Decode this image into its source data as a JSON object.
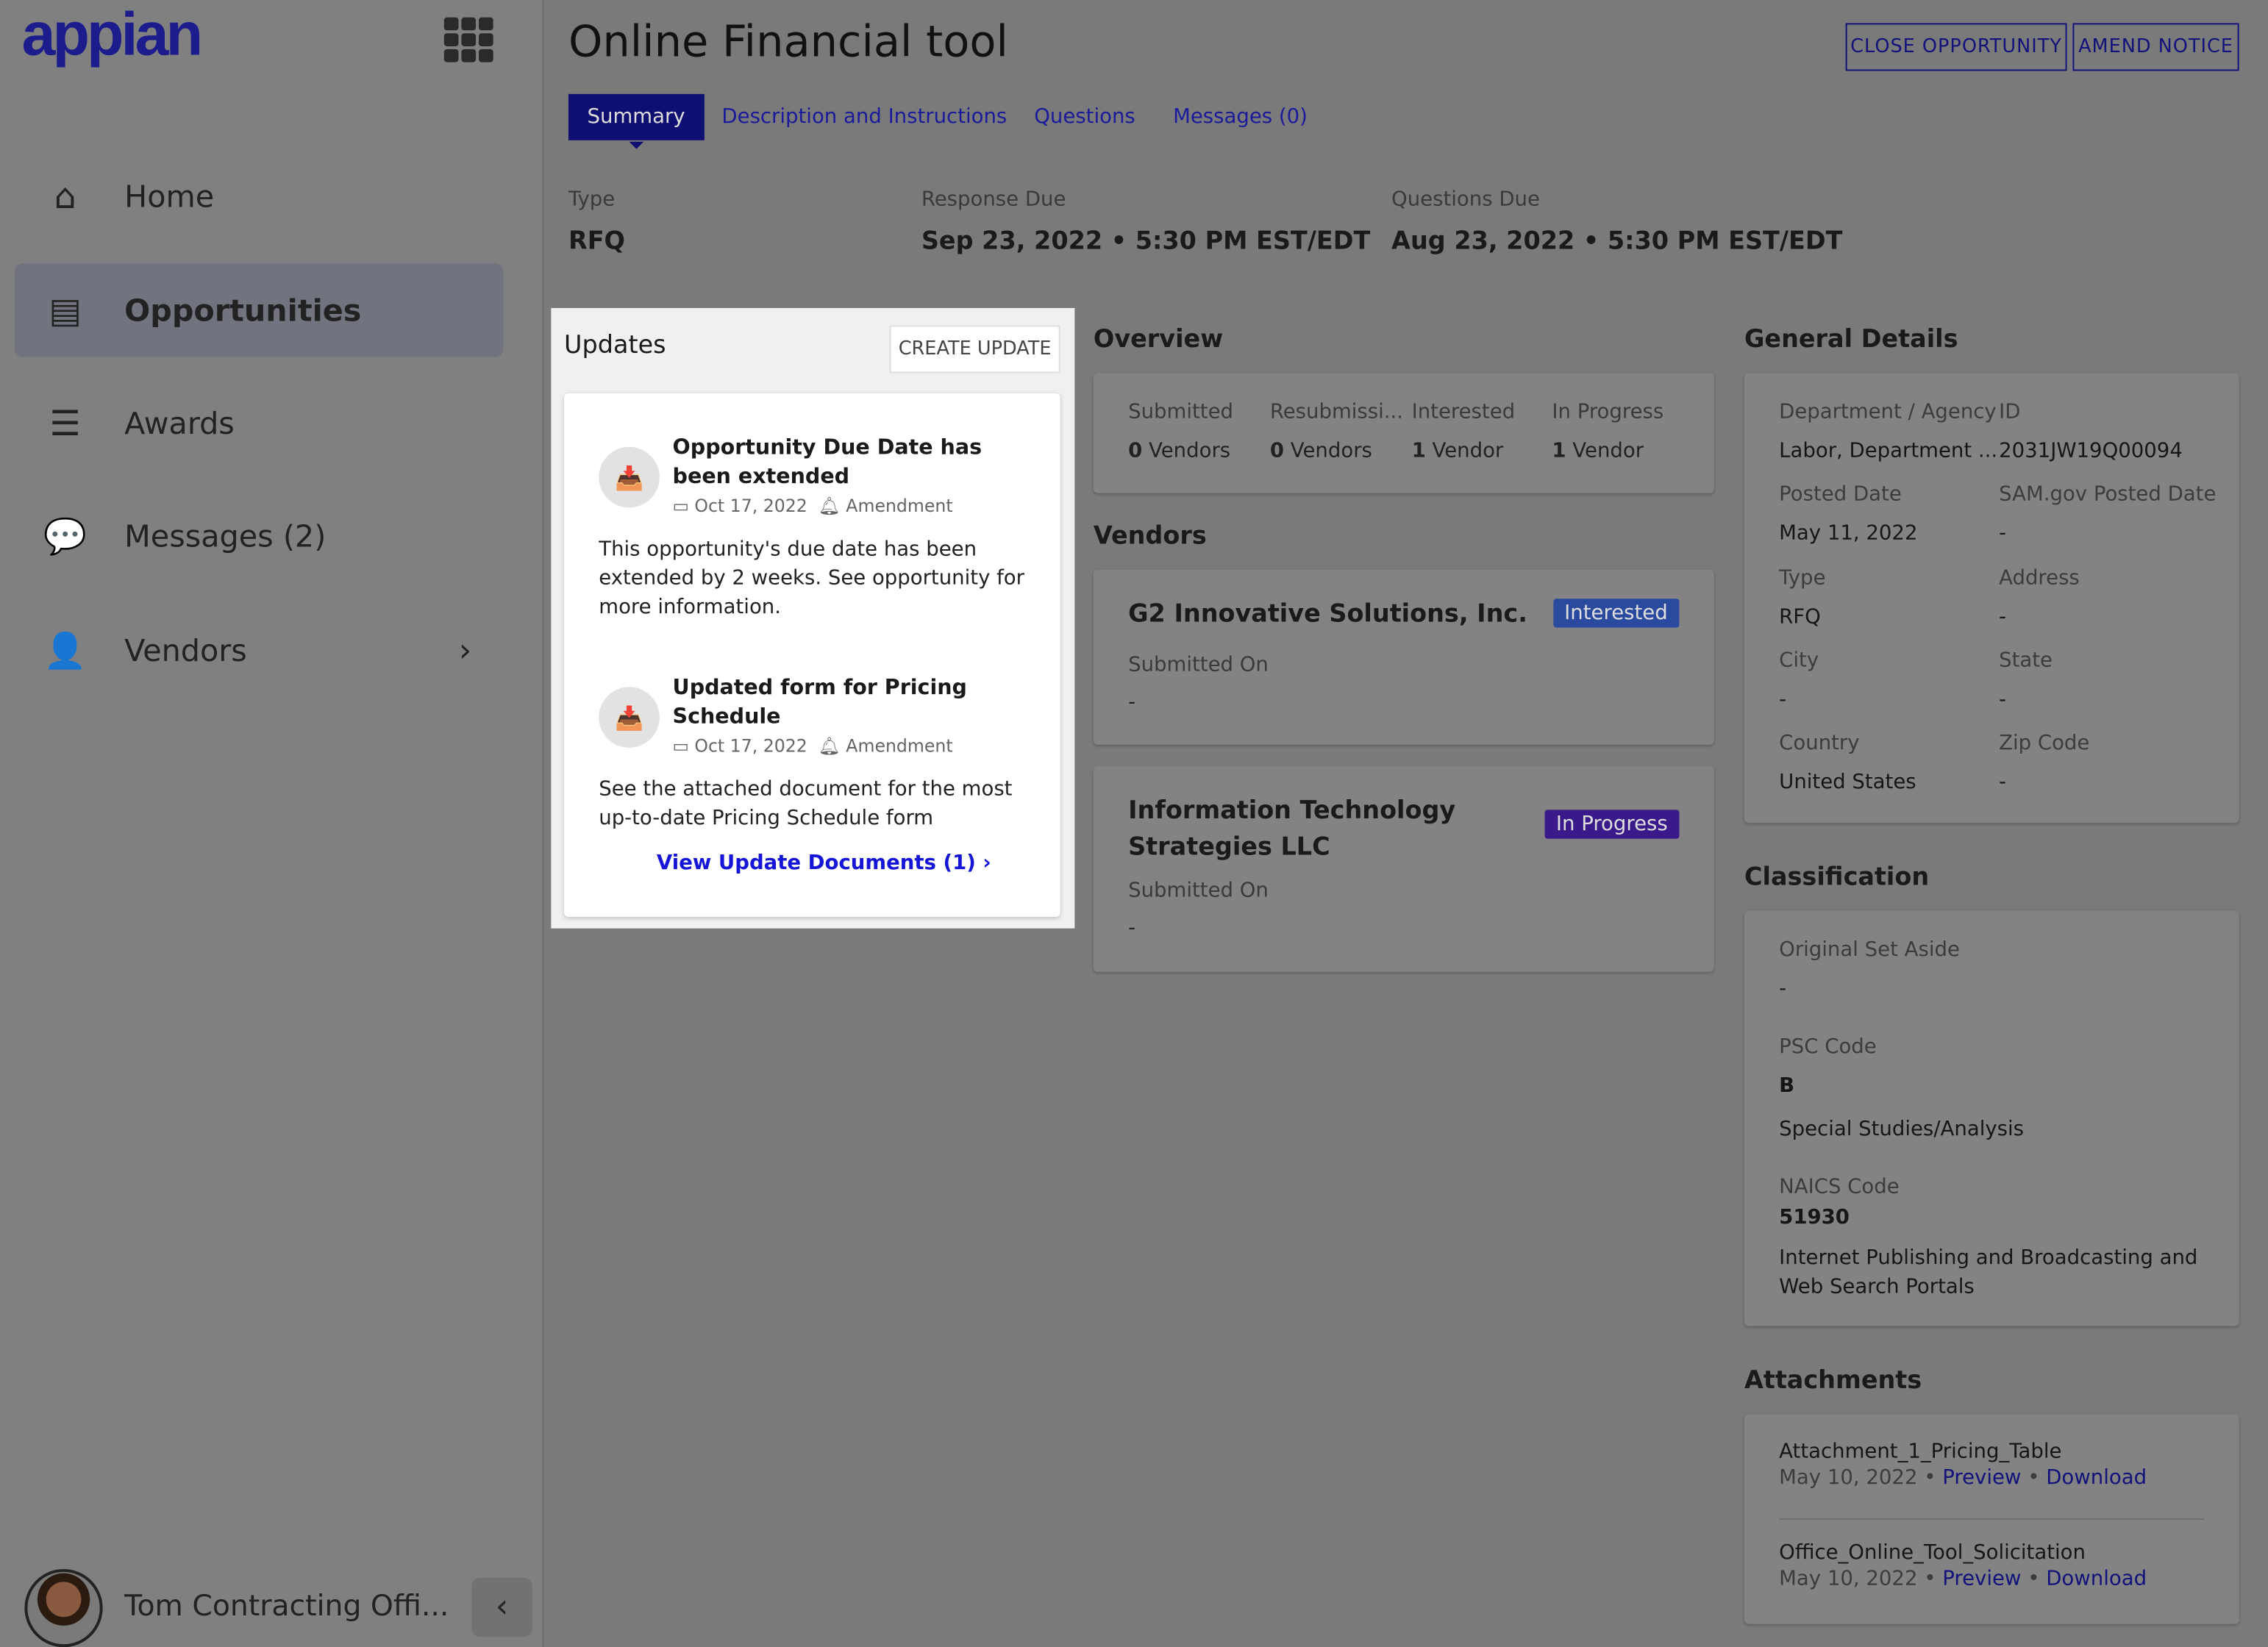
{
  "app": {
    "logo": "appian",
    "grid_icon": "app-grid-icon"
  },
  "sidebar": {
    "items": [
      {
        "label": "Home",
        "icon": "home-icon"
      },
      {
        "label": "Opportunities",
        "icon": "list-box-icon",
        "selected": true
      },
      {
        "label": "Awards",
        "icon": "bullet-list-icon"
      },
      {
        "label": "Messages (2)",
        "icon": "chat-bubble-icon"
      },
      {
        "label": "Vendors",
        "icon": "user-icon",
        "has_submenu": true
      }
    ],
    "user": "Tom Contracting Offi..."
  },
  "header": {
    "title": "Online Financial tool",
    "close_button": "CLOSE OPPORTUNITY",
    "amend_button": "AMEND NOTICE"
  },
  "tabs": [
    "Summary",
    "Description and Instructions",
    "Questions",
    "Messages (0)"
  ],
  "summary": {
    "type_label": "Type",
    "type": "RFQ",
    "response_label": "Response Due",
    "response": "Sep 23, 2022 • 5:30 PM EST/EDT",
    "questions_label": "Questions Due",
    "questions": "Aug 23, 2022 • 5:30 PM EST/EDT"
  },
  "updates": {
    "title": "Updates",
    "create_button": "CREATE UPDATE",
    "items": [
      {
        "title": "Opportunity Due Date has been extended",
        "date": "Oct 17, 2022",
        "kind": "Amendment",
        "body": "This opportunity's due date has been extended by 2 weeks. See opportunity for more information."
      },
      {
        "title": "Updated form for Pricing Schedule",
        "date": "Oct 17, 2022",
        "kind": "Amendment",
        "body": "See the attached document for the most up-to-date Pricing Schedule form",
        "link": "View Update Documents (1)"
      }
    ]
  },
  "overview": {
    "title": "Overview",
    "stats": [
      {
        "label": "Submitted",
        "num": "0",
        "unit": "Vendors"
      },
      {
        "label": "Resubmissi...",
        "num": "0",
        "unit": "Vendors"
      },
      {
        "label": "Interested",
        "num": "1",
        "unit": "Vendor"
      },
      {
        "label": "In Progress",
        "num": "1",
        "unit": "Vendor"
      }
    ]
  },
  "vendors": {
    "title": "Vendors",
    "items": [
      {
        "name": "G2 Innovative Solutions, Inc.",
        "status": "Interested",
        "status_color": "#2a4aa0",
        "submitted_label": "Submitted On",
        "submitted": "-"
      },
      {
        "name": "Information Technology Strategies LLC",
        "status": "In Progress",
        "status_color": "#3a1a8a",
        "submitted_label": "Submitted On",
        "submitted": "-"
      }
    ]
  },
  "general": {
    "title": "General Details",
    "fields": [
      {
        "label": "Department / Agency",
        "value": "Labor, Department ..."
      },
      {
        "label": "ID",
        "value": "2031JW19Q00094"
      },
      {
        "label": "Posted Date",
        "value": "May 11, 2022"
      },
      {
        "label": "SAM.gov Posted Date",
        "value": "-"
      },
      {
        "label": "Type",
        "value": "RFQ"
      },
      {
        "label": "Address",
        "value": "-"
      },
      {
        "label": "City",
        "value": "-"
      },
      {
        "label": "State",
        "value": "-"
      },
      {
        "label": "Country",
        "value": "United States"
      },
      {
        "label": "Zip Code",
        "value": "-"
      }
    ]
  },
  "classification": {
    "title": "Classification",
    "set_aside_label": "Original Set Aside",
    "set_aside": "-",
    "psc_label": "PSC Code",
    "psc": "B",
    "psc_desc": "Special Studies/Analysis",
    "naics_label": "NAICS Code",
    "naics": "51930",
    "naics_desc": "Internet Publishing and Broadcasting and Web Search Portals"
  },
  "attachments": {
    "title": "Attachments",
    "items": [
      {
        "name": "Attachment_1_Pricing_Table",
        "date": "May 10, 2022",
        "preview": "Preview",
        "download": "Download"
      },
      {
        "name": "Office_Online_Tool_Solicitation",
        "date": "May 10, 2022",
        "preview": "Preview",
        "download": "Download"
      }
    ]
  }
}
